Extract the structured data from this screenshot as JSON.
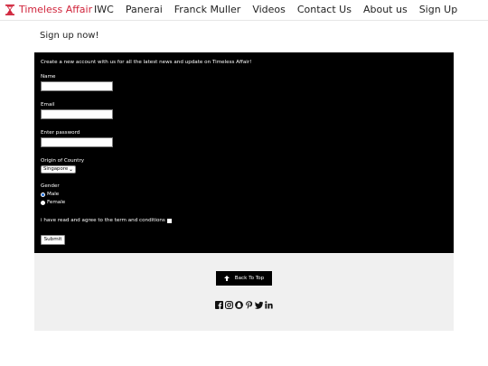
{
  "nav": {
    "brand": "Timeless Affair",
    "links": [
      "IWC",
      "Panerai",
      "Franck Muller",
      "Videos",
      "Contact Us",
      "About us",
      "Sign Up"
    ]
  },
  "page_title": "Sign up now!",
  "form": {
    "intro": "Create a new account with us for all the latest news and update on Timeless Affair!",
    "name_label": "Name",
    "email_label": "Email",
    "password_label": "Enter password",
    "country_label": "Origin of Country",
    "country_value": "Singapore",
    "gender_label": "Gender",
    "gender_options": [
      "Male",
      "Female"
    ],
    "gender_selected": "Male",
    "agree_text": "i have read and agree to the term and conditions",
    "submit_label": "Submit"
  },
  "footer": {
    "back_to_top": "Back To Top",
    "social_icons": [
      "facebook-icon",
      "instagram-icon",
      "snapchat-icon",
      "pinterest-icon",
      "twitter-icon",
      "linkedin-icon"
    ]
  },
  "colors": {
    "brand": "#d0243b",
    "panel_bg": "#000000",
    "footer_bg": "#f0f0f0"
  }
}
